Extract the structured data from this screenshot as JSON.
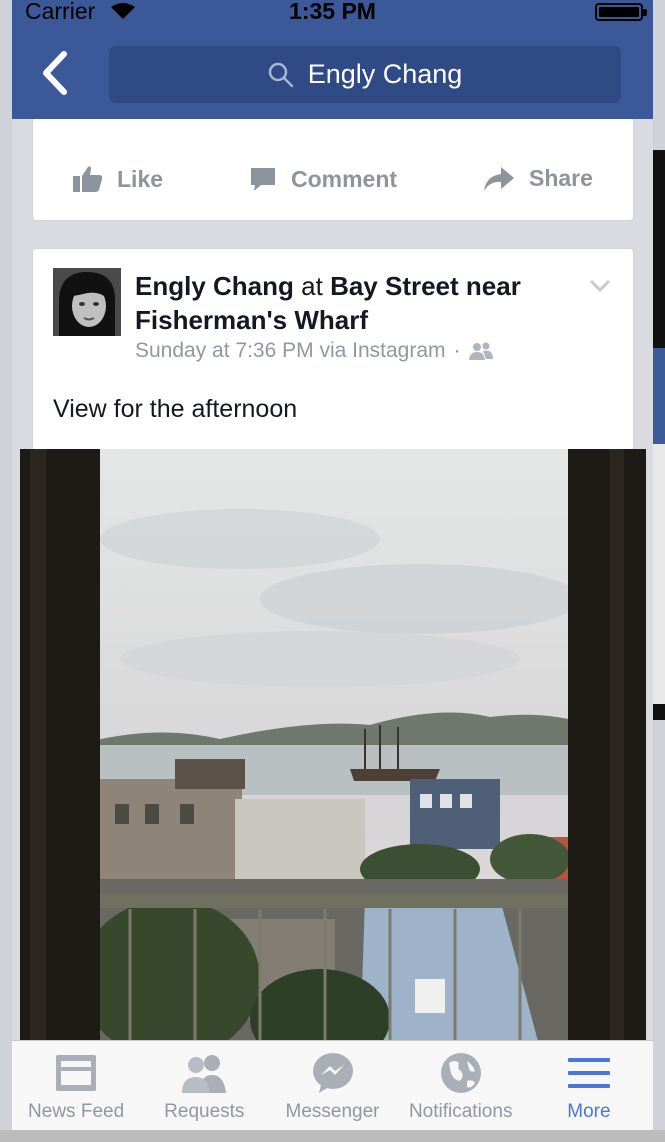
{
  "status_bar": {
    "carrier": "Carrier",
    "time": "1:35 PM"
  },
  "search": {
    "query": "Engly Chang"
  },
  "previous_post_actions": {
    "like": "Like",
    "comment": "Comment",
    "share": "Share"
  },
  "post": {
    "author": "Engly Chang",
    "at_word": "at",
    "location": "Bay Street near Fisherman's Wharf",
    "timestamp": "Sunday at 7:36 PM via Instagram",
    "separator": "·",
    "text": "View for the afternoon",
    "audience_icon": "friends-icon"
  },
  "tab_bar": {
    "tabs": [
      {
        "label": "News Feed",
        "icon": "news-feed-icon"
      },
      {
        "label": "Requests",
        "icon": "requests-icon"
      },
      {
        "label": "Messenger",
        "icon": "messenger-icon"
      },
      {
        "label": "Notifications",
        "icon": "globe-icon"
      },
      {
        "label": "More",
        "icon": "menu-icon"
      }
    ],
    "active_index": 4
  },
  "colors": {
    "brand_blue": "#3b5998",
    "tab_active": "#4a76d9",
    "muted_text": "#9197a3"
  }
}
